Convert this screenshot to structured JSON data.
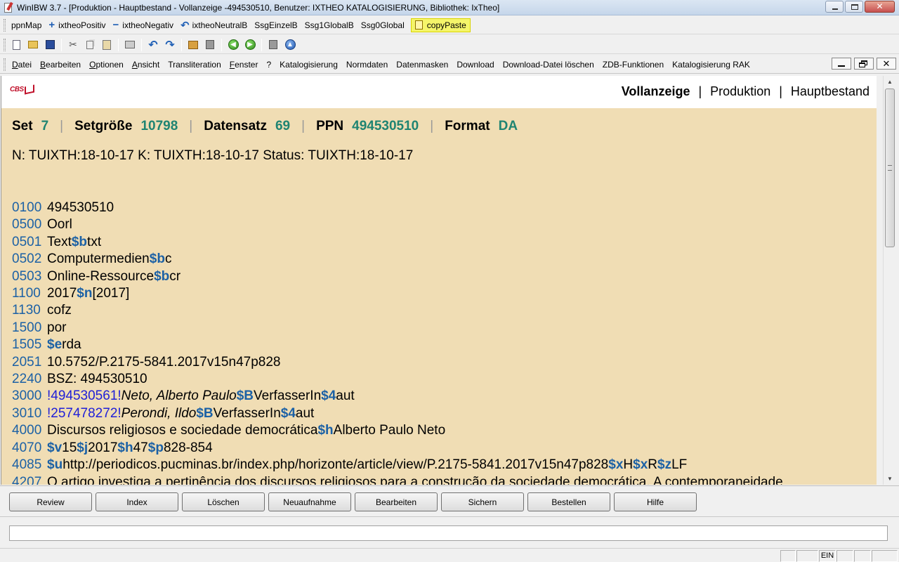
{
  "window": {
    "title": "WinIBW 3.7 - [Produktion - Hauptbestand - Vollanzeige -494530510, Benutzer: IXTHEO KATALOGISIERUNG, Bibliothek: IxTheo]",
    "close_glyph": "✕"
  },
  "toolbar_scripts": {
    "ppnmap": "ppnMap",
    "positiv": "ixtheoPositiv",
    "negativ": "ixtheoNegativ",
    "neutral": "ixtheoNeutralB",
    "ssg_einzel": "SsgEinzelB",
    "ssg1_global": "Ssg1GlobalB",
    "ssg0_global": "Ssg0Global",
    "copy_paste": "copyPaste",
    "plus_glyph": "+",
    "minus_glyph": "−",
    "undo_glyph": "↶"
  },
  "icons": {
    "cut": "✂",
    "undo": "↶",
    "redo": "↷",
    "back": "◀",
    "forward": "▶",
    "up": "▲"
  },
  "menu": {
    "datei": "Datei",
    "bearbeiten": "Bearbeiten",
    "optionen": "Optionen",
    "ansicht": "Ansicht",
    "transliteration": "Transliteration",
    "fenster": "Fenster",
    "help": "?",
    "katalogisierung": "Katalogisierung",
    "normdaten": "Normdaten",
    "datenmasken": "Datenmasken",
    "download": "Download",
    "download_loeschen": "Download-Datei löschen",
    "zdb": "ZDB-Funktionen",
    "rak": "Katalogisierung RAK",
    "close_glyph": "✕"
  },
  "header": {
    "logo_text": "CBS",
    "vollanzeige": "Vollanzeige",
    "produktion": "Produktion",
    "hauptbestand": "Hauptbestand",
    "separator": "|"
  },
  "status": {
    "set_label": "Set",
    "set_value": "7",
    "setgroesse_label": "Setgröße",
    "setgroesse_value": "10798",
    "datensatz_label": "Datensatz",
    "datensatz_value": "69",
    "ppn_label": "PPN",
    "ppn_value": "494530510",
    "format_label": "Format",
    "format_value": "DA",
    "separator": "|"
  },
  "dates_line": "N: TUIXTH:18-10-17 K: TUIXTH:18-10-17 Status: TUIXTH:18-10-17",
  "record": [
    {
      "tag": "0100",
      "text": "494530510"
    },
    {
      "tag": "0500",
      "text": "Oorl"
    },
    {
      "tag": "0501",
      "p1": "Text",
      "s1": "$b",
      "p2": "txt"
    },
    {
      "tag": "0502",
      "p1": "Computermedien",
      "s1": "$b",
      "p2": "c"
    },
    {
      "tag": "0503",
      "p1": "Online-Ressource",
      "s1": "$b",
      "p2": "cr"
    },
    {
      "tag": "1100",
      "p1": "2017",
      "s1": "$n",
      "p2": "[2017]"
    },
    {
      "tag": "1130",
      "text": "cofz"
    },
    {
      "tag": "1500",
      "text": "por"
    },
    {
      "tag": "1505",
      "s1": "$e",
      "p2": "rda"
    },
    {
      "tag": "2051",
      "text": "10.5752/P.2175-5841.2017v15n47p828"
    },
    {
      "tag": "2240",
      "text": "BSZ: 494530510"
    },
    {
      "tag": "3000",
      "link": "!494530561!",
      "name": "Neto, Alberto Paulo",
      "s1": "$B",
      "role": "VerfasserIn",
      "s2": "$4",
      "code": "aut"
    },
    {
      "tag": "3010",
      "link": "!257478272!",
      "name": "Perondi, Ildo",
      "s1": "$B",
      "role": "VerfasserIn",
      "s2": "$4",
      "code": "aut"
    },
    {
      "tag": "4000",
      "p1": "Discursos religiosos e sociedade democrática",
      "s1": "$h",
      "p2": "Alberto Paulo Neto"
    },
    {
      "tag": "4070",
      "s1": "$v",
      "p1": "15",
      "s2": "$j",
      "p2": "2017",
      "s3": "$h",
      "p3": "47",
      "s4": "$p",
      "p4": "828-854"
    },
    {
      "tag": "4085",
      "s1": "$u",
      "p1": "http://periodicos.pucminas.br/index.php/horizonte/article/view/P.2175-5841.2017v15n47p828",
      "s2": "$x",
      "p2": "H",
      "s3": "$x",
      "p3": "R",
      "s4": "$z",
      "p4": "LF"
    },
    {
      "tag": "4207",
      "text": "O artigo investiga a pertinência dos discursos religiosos para a construção da sociedade democrática. A contemporaneidade"
    }
  ],
  "buttons": {
    "review": "Review",
    "index": "Index",
    "loeschen": "Löschen",
    "neuaufnahme": "Neuaufnahme",
    "bearbeiten": "Bearbeiten",
    "sichern": "Sichern",
    "bestellen": "Bestellen",
    "hilfe": "Hilfe"
  },
  "command_input": {
    "value": ""
  },
  "statusbar": {
    "ein": "EIN"
  },
  "scrollbar": {
    "up": "▲",
    "down": "▼"
  }
}
